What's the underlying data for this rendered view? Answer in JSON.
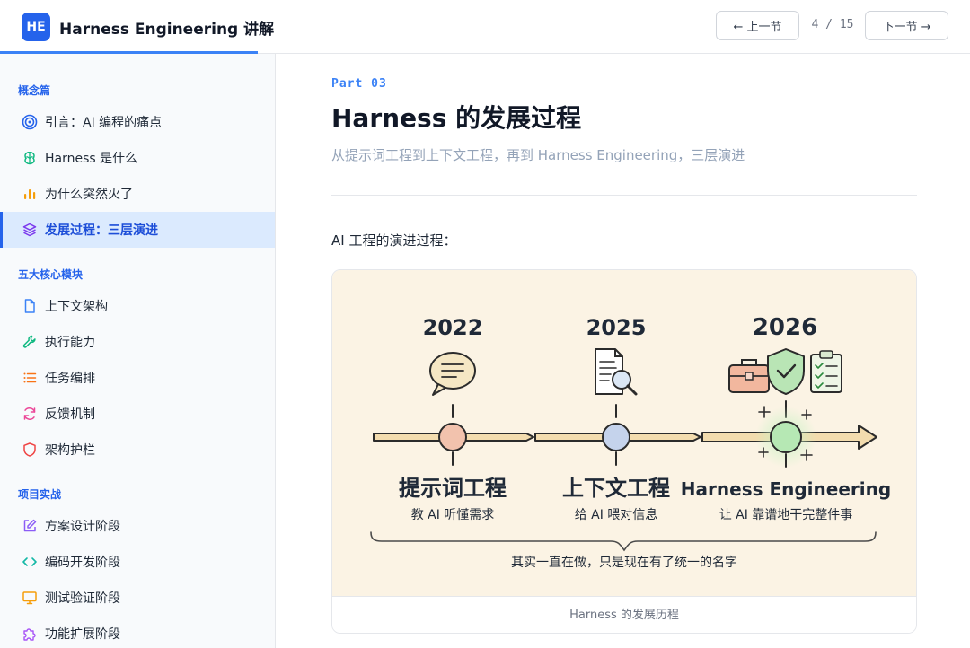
{
  "header": {
    "logo_text": "HE",
    "title": "Harness Engineering 讲解",
    "prev_label": "← 上一节",
    "next_label": "下一节 →",
    "page_indicator": "4 / 15"
  },
  "sidebar": {
    "sections": [
      {
        "title": "概念篇",
        "items": [
          {
            "label": "引言：AI 编程的痛点",
            "icon": "target-icon"
          },
          {
            "label": "Harness 是什么",
            "icon": "brain-icon"
          },
          {
            "label": "为什么突然火了",
            "icon": "bar-chart-icon"
          },
          {
            "label": "发展过程：三层演进",
            "icon": "layers-icon",
            "active": true
          }
        ]
      },
      {
        "title": "五大核心模块",
        "items": [
          {
            "label": "上下文架构",
            "icon": "file-icon"
          },
          {
            "label": "执行能力",
            "icon": "wrench-icon"
          },
          {
            "label": "任务编排",
            "icon": "list-icon"
          },
          {
            "label": "反馈机制",
            "icon": "refresh-icon"
          },
          {
            "label": "架构护栏",
            "icon": "shield-icon"
          }
        ]
      },
      {
        "title": "项目实战",
        "items": [
          {
            "label": "方案设计阶段",
            "icon": "edit-icon"
          },
          {
            "label": "编码开发阶段",
            "icon": "code-icon"
          },
          {
            "label": "测试验证阶段",
            "icon": "monitor-icon"
          },
          {
            "label": "功能扩展阶段",
            "icon": "puzzle-icon"
          }
        ]
      }
    ]
  },
  "main": {
    "part_label": "Part 03",
    "title": "Harness 的发展过程",
    "subtitle": "从提示词工程到上下文工程，再到 Harness Engineering，三层演进",
    "intro": "AI 工程的演进过程：",
    "caption": "Harness 的发展历程"
  },
  "timeline": {
    "stages": [
      {
        "year": "2022",
        "name": "提示词工程",
        "desc": "教 AI 听懂需求",
        "color": "#f2c2ad"
      },
      {
        "year": "2025",
        "name": "上下文工程",
        "desc": "给 AI 喂对信息",
        "color": "#c5d3ec"
      },
      {
        "year": "2026",
        "name": "Harness Engineering",
        "desc": "让 AI 靠谱地干完整件事",
        "color": "#b6e8b4"
      }
    ],
    "summary": "其实一直在做，只是现在有了统一的名字"
  },
  "colors": {
    "accent": "#2563eb",
    "figure_bg": "#fbf3e4"
  }
}
